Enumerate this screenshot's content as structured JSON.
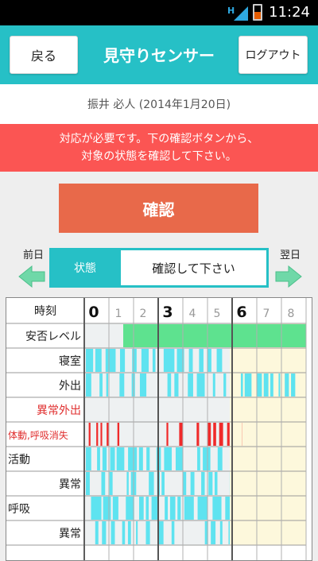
{
  "status_bar": {
    "time": "11:24",
    "network": "H",
    "icons": [
      "signal-icon",
      "battery-icon"
    ]
  },
  "header": {
    "back_label": "戻る",
    "title": "見守りセンサー",
    "logout_label": "ログアウト"
  },
  "user": {
    "name_line": "振井 必人 (2014年1月20日)"
  },
  "alert": {
    "line1": "対応が必要です。下の確認ボタンから、",
    "line2": "対象の状態を確認して下さい。"
  },
  "confirm_button": "確認",
  "day_nav": {
    "prev_label": "前日",
    "next_label": "翌日"
  },
  "status": {
    "key": "状態",
    "value": "確認して下さい"
  },
  "timeline": {
    "header_label": "時刻",
    "hours": [
      "0",
      "1",
      "2",
      "3",
      "4",
      "5",
      "6",
      "7",
      "8"
    ],
    "rows": [
      {
        "label": "安否レベル",
        "color": "#222222"
      },
      {
        "label": "寝室",
        "color": "#222222"
      },
      {
        "label": "外出",
        "color": "#222222"
      },
      {
        "label": "異常外出",
        "color": "#e03030"
      },
      {
        "label": "体動,呼吸消失",
        "color": "#e03030"
      },
      {
        "label": "活動",
        "color": "#222222"
      },
      {
        "label": "異常",
        "color": "#222222"
      },
      {
        "label": "呼吸",
        "color": "#222222"
      },
      {
        "label": "異常",
        "color": "#222222"
      }
    ],
    "colors": {
      "safety": "#5ee28f",
      "activity": "#5ee3f0",
      "alert": "#f02a2a",
      "past_bg": "#eef1f2",
      "future_bg": "#fdf8dc",
      "accent": "#26c0c6"
    }
  }
}
